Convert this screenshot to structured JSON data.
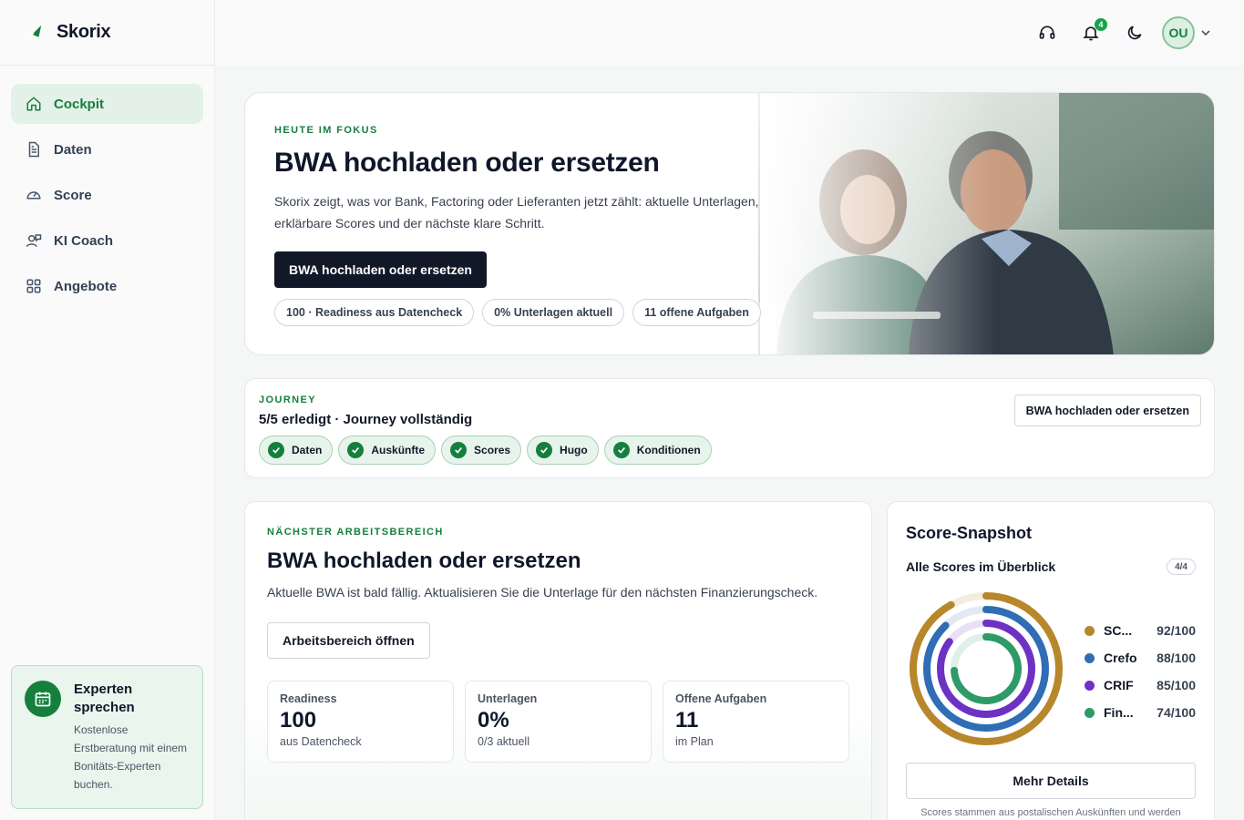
{
  "brand": {
    "name": "Skorix"
  },
  "sidebar": {
    "items": [
      {
        "label": "Cockpit",
        "icon": "home-icon",
        "active": true
      },
      {
        "label": "Daten",
        "icon": "document-icon"
      },
      {
        "label": "Score",
        "icon": "gauge-icon"
      },
      {
        "label": "KI Coach",
        "icon": "coach-icon"
      },
      {
        "label": "Angebote",
        "icon": "grid-icon"
      }
    ],
    "expert": {
      "title": "Experten sprechen",
      "description": "Kostenlose Erstberatung mit einem Bonitäts-Experten buchen."
    }
  },
  "topbar": {
    "notification_count": "4",
    "avatar_initials": "OU",
    "icons": [
      "headset-icon",
      "bell-icon",
      "moon-icon",
      "chevron-down-icon"
    ]
  },
  "hero": {
    "eyebrow": "HEUTE IM FOKUS",
    "title": "BWA hochladen oder ersetzen",
    "description": "Skorix zeigt, was vor Bank, Factoring oder Lieferanten jetzt zählt: aktuelle Unterlagen, erklärbare Scores und der nächste klare Schritt.",
    "button": "BWA hochladen oder ersetzen",
    "chips": [
      "100 · Readiness aus Datencheck",
      "0% Unterlagen aktuell",
      "11 offene Aufgaben"
    ]
  },
  "journey": {
    "eyebrow": "JOURNEY",
    "status": "5/5 erledigt · Journey vollständig",
    "steps": [
      "Daten",
      "Auskünfte",
      "Scores",
      "Hugo",
      "Konditionen"
    ],
    "button": "BWA hochladen oder ersetzen"
  },
  "work": {
    "eyebrow": "NÄCHSTER ARBEITSBEREICH",
    "title": "BWA hochladen oder ersetzen",
    "description": "Aktuelle BWA ist bald fällig. Aktualisieren Sie die Unterlage für den nächsten Finanzierungscheck.",
    "button": "Arbeitsbereich öffnen",
    "stats": [
      {
        "label": "Readiness",
        "value": "100",
        "sub": "aus Datencheck"
      },
      {
        "label": "Unterlagen",
        "value": "0%",
        "sub": "0/3 aktuell"
      },
      {
        "label": "Offene Aufgaben",
        "value": "11",
        "sub": "im Plan"
      }
    ]
  },
  "snapshot": {
    "title": "Score-Snapshot",
    "subtitle": "Alle Scores im Überblick",
    "count": "4/4",
    "scores": [
      {
        "name": "SC...",
        "value": "92/100",
        "pct": 92,
        "color": "#b8862b"
      },
      {
        "name": "Crefo",
        "value": "88/100",
        "pct": 88,
        "color": "#2f6db5"
      },
      {
        "name": "CRIF",
        "value": "85/100",
        "pct": 85,
        "color": "#6d31c4"
      },
      {
        "name": "Fin...",
        "value": "74/100",
        "pct": 74,
        "color": "#2e9b66"
      }
    ],
    "button": "Mehr Details",
    "note": "Scores stammen aus postalischen Auskünften und werden"
  }
}
